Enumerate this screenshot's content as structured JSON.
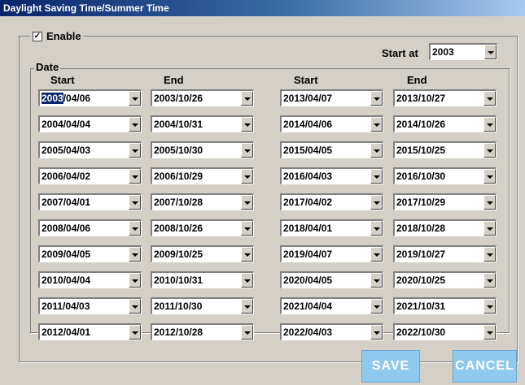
{
  "window": {
    "title": "Daylight Saving Time/Summer Time"
  },
  "enable": {
    "checked": true,
    "check_glyph": "✓",
    "label": "Enable"
  },
  "start_at": {
    "label": "Start at",
    "value": "2003"
  },
  "date_group": {
    "label": "Date"
  },
  "columns": [
    "Start",
    "End",
    "Start",
    "End"
  ],
  "rows": [
    [
      "2003/04/06",
      "2003/10/26",
      "2013/04/07",
      "2013/10/27"
    ],
    [
      "2004/04/04",
      "2004/10/31",
      "2014/04/06",
      "2014/10/26"
    ],
    [
      "2005/04/03",
      "2005/10/30",
      "2015/04/05",
      "2015/10/25"
    ],
    [
      "2006/04/02",
      "2006/10/29",
      "2016/04/03",
      "2016/10/30"
    ],
    [
      "2007/04/01",
      "2007/10/28",
      "2017/04/02",
      "2017/10/29"
    ],
    [
      "2008/04/06",
      "2008/10/26",
      "2018/04/01",
      "2018/10/28"
    ],
    [
      "2009/04/05",
      "2009/10/25",
      "2019/04/07",
      "2019/10/27"
    ],
    [
      "2010/04/04",
      "2010/10/31",
      "2020/04/05",
      "2020/10/25"
    ],
    [
      "2011/04/03",
      "2011/10/30",
      "2021/04/04",
      "2021/10/31"
    ],
    [
      "2012/04/01",
      "2012/10/28",
      "2022/04/03",
      "2022/10/30"
    ]
  ],
  "buttons": {
    "save": "SAVE",
    "cancel": "CANCEL"
  },
  "colors": {
    "button_bg": "#8fc9ed",
    "titlebar": "#0a246a"
  }
}
